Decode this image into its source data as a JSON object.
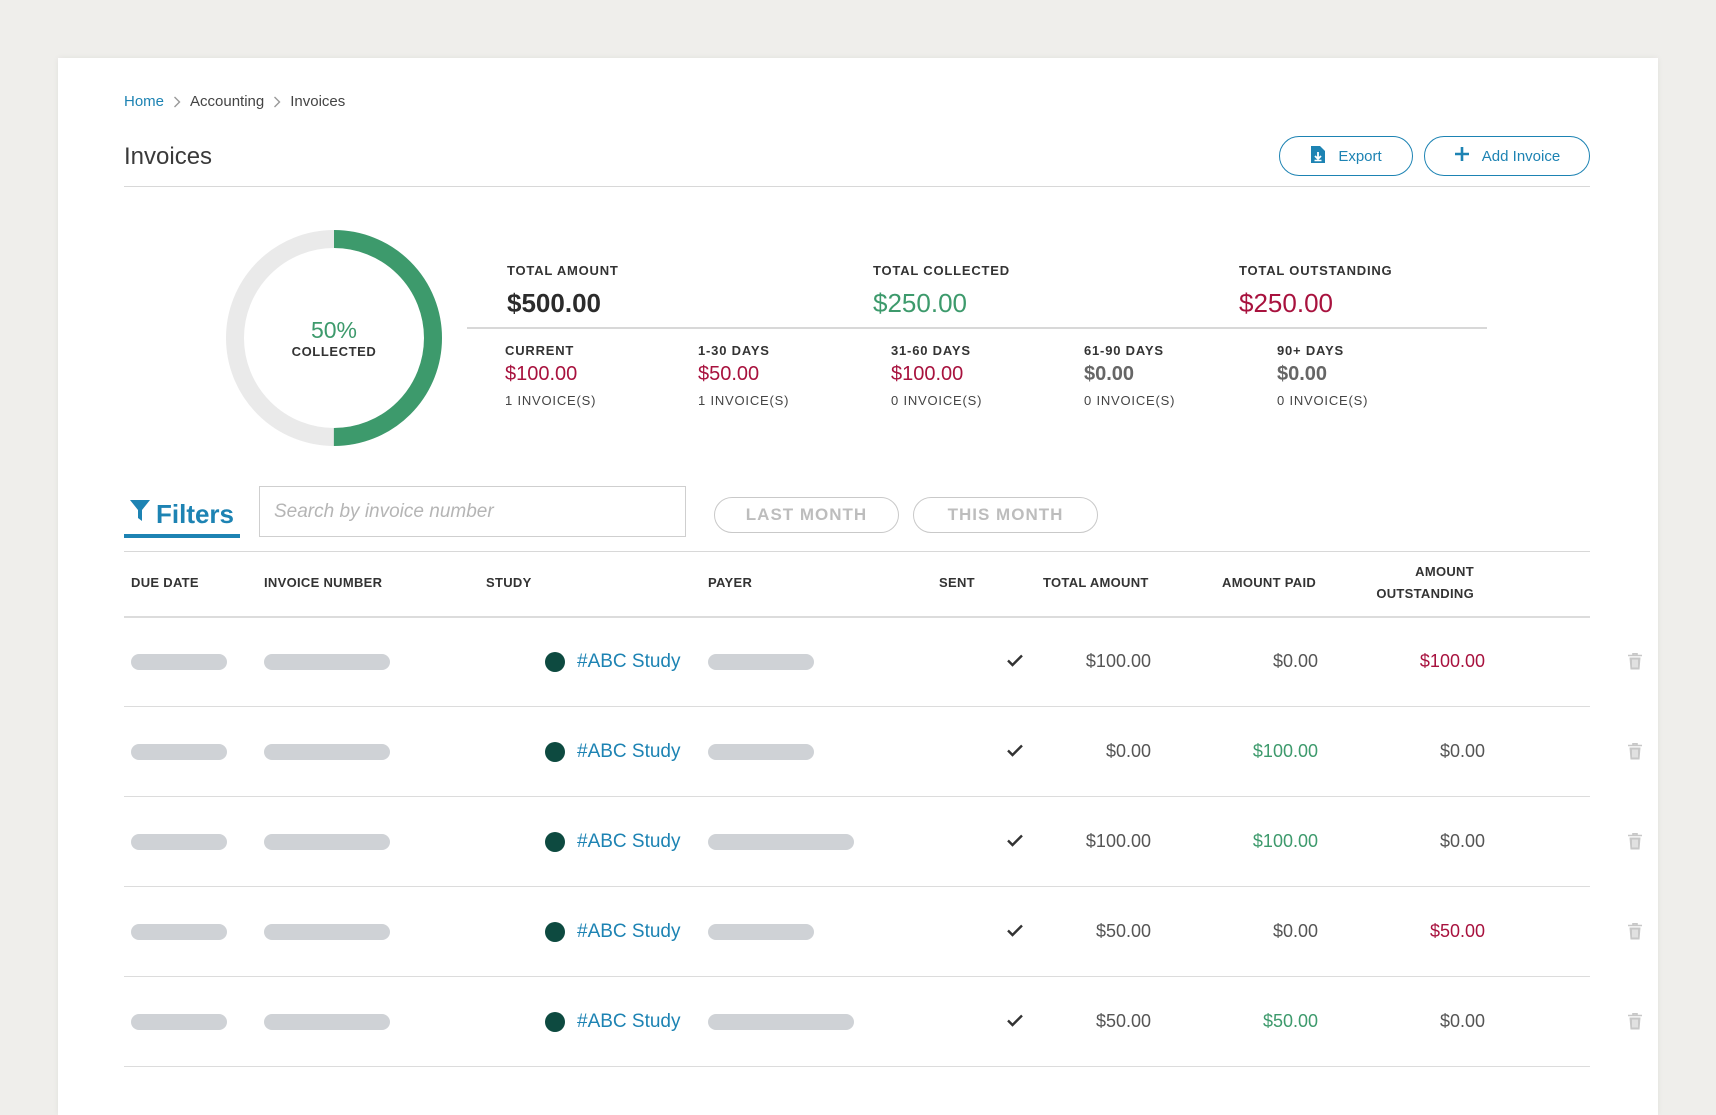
{
  "breadcrumb": {
    "home": "Home",
    "accounting": "Accounting",
    "invoices": "Invoices"
  },
  "page_title": "Invoices",
  "actions": {
    "export_label": "Export",
    "add_label": "Add Invoice"
  },
  "summary": {
    "collected_percent": 50,
    "collected_percent_label": "50%",
    "collected_label": "COLLECTED",
    "total_amount_label": "TOTAL AMOUNT",
    "total_amount": "$500.00",
    "total_collected_label": "TOTAL COLLECTED",
    "total_collected": "$250.00",
    "total_outstanding_label": "TOTAL OUTSTANDING",
    "total_outstanding": "$250.00"
  },
  "aging": [
    {
      "label": "CURRENT",
      "value": "$100.00",
      "count": "1 INVOICE(S)",
      "tone": "red"
    },
    {
      "label": "1-30 DAYS",
      "value": "$50.00",
      "count": "1 INVOICE(S)",
      "tone": "red"
    },
    {
      "label": "31-60 DAYS",
      "value": "$100.00",
      "count": "0 INVOICE(S)",
      "tone": "red"
    },
    {
      "label": "61-90 DAYS",
      "value": "$0.00",
      "count": "0 INVOICE(S)",
      "tone": "gray"
    },
    {
      "label": "90+ DAYS",
      "value": "$0.00",
      "count": "0 INVOICE(S)",
      "tone": "gray"
    }
  ],
  "filters": {
    "label": "Filters",
    "search_placeholder": "Search by invoice number",
    "last_month": "LAST MONTH",
    "this_month": "THIS MONTH"
  },
  "table": {
    "headers": {
      "due_date": "DUE DATE",
      "invoice_number": "INVOICE NUMBER",
      "study": "STUDY",
      "payer": "PAYER",
      "sent": "SENT",
      "total_amount": "TOTAL AMOUNT",
      "amount_paid": "AMOUNT PAID",
      "amount_outstanding_1": "AMOUNT",
      "amount_outstanding_2": "OUTSTANDING"
    },
    "rows": [
      {
        "study": "#ABC Study",
        "sent": true,
        "total": "$100.00",
        "paid": "$0.00",
        "paid_tone": "gray",
        "outstanding": "$100.00",
        "outstanding_tone": "red",
        "payer_width": "short"
      },
      {
        "study": "#ABC Study",
        "sent": true,
        "total": "$0.00",
        "paid": "$100.00",
        "paid_tone": "green",
        "outstanding": "$0.00",
        "outstanding_tone": "gray",
        "payer_width": "short"
      },
      {
        "study": "#ABC Study",
        "sent": true,
        "total": "$100.00",
        "paid": "$100.00",
        "paid_tone": "green",
        "outstanding": "$0.00",
        "outstanding_tone": "gray",
        "payer_width": "long"
      },
      {
        "study": "#ABC Study",
        "sent": true,
        "total": "$50.00",
        "paid": "$0.00",
        "paid_tone": "gray",
        "outstanding": "$50.00",
        "outstanding_tone": "red",
        "payer_width": "short"
      },
      {
        "study": "#ABC Study",
        "sent": true,
        "total": "$50.00",
        "paid": "$50.00",
        "paid_tone": "green",
        "outstanding": "$0.00",
        "outstanding_tone": "gray",
        "payer_width": "long"
      }
    ]
  },
  "colors": {
    "accent": "#1d83b3",
    "green": "#3d9a6c",
    "red": "#a8123e",
    "study_dot": "#0d4a40"
  }
}
